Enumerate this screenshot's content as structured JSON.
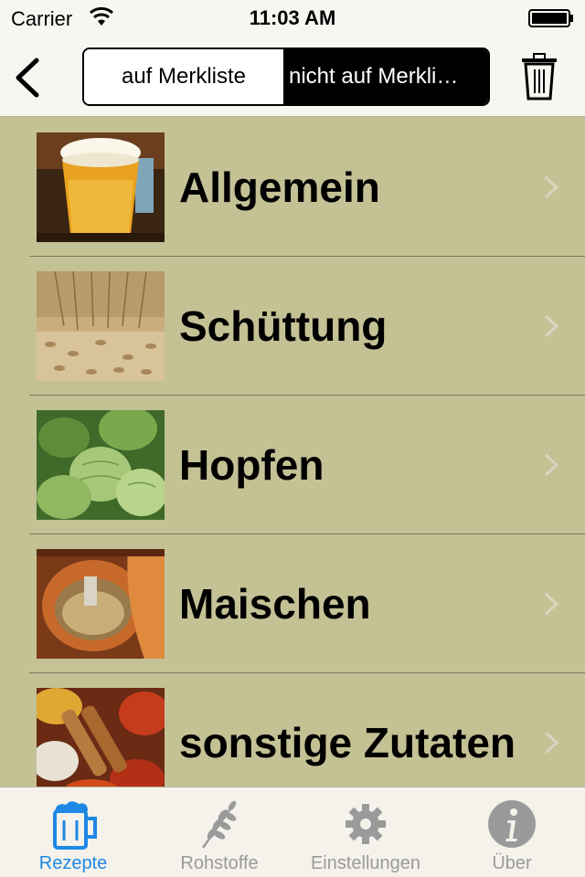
{
  "status": {
    "carrier": "Carrier",
    "time": "11:03 AM"
  },
  "navbar": {
    "segments": [
      "auf Merkliste",
      "nicht auf Merkli…"
    ],
    "selected_segment": "nicht auf Merkli…"
  },
  "list": {
    "items": [
      {
        "label": "Allgemein",
        "image": "beer-glass"
      },
      {
        "label": "Schüttung",
        "image": "barley-grain"
      },
      {
        "label": "Hopfen",
        "image": "hops"
      },
      {
        "label": "Maischen",
        "image": "copper-mash-tun"
      },
      {
        "label": "sonstige Zutaten",
        "image": "spices"
      }
    ]
  },
  "tabbar": {
    "tabs": [
      {
        "label": "Rezepte",
        "icon": "beer-mug-icon",
        "active": true
      },
      {
        "label": "Rohstoffe",
        "icon": "wheat-icon",
        "active": false
      },
      {
        "label": "Einstellungen",
        "icon": "gear-icon",
        "active": false
      },
      {
        "label": "Über",
        "icon": "info-icon",
        "active": false
      }
    ]
  },
  "colors": {
    "background": "#c4c195",
    "accent": "#1e88e5",
    "chrome": "#f7f7f2"
  }
}
